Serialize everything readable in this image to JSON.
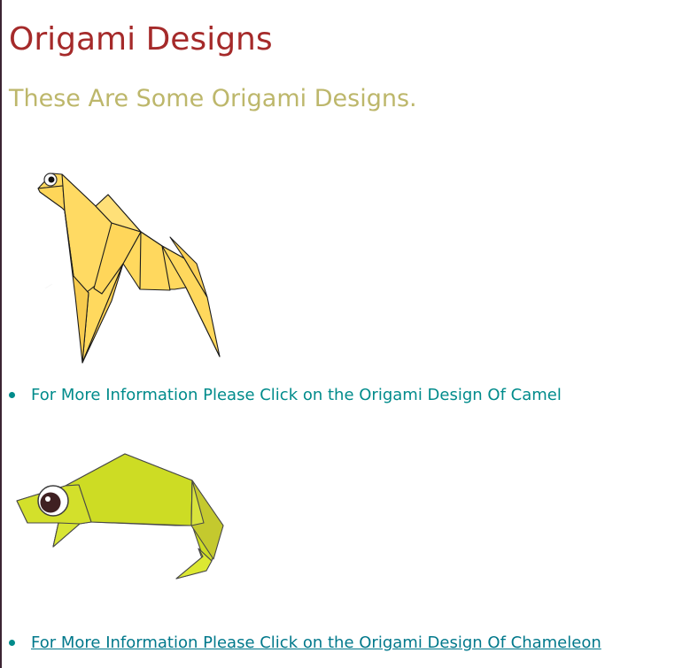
{
  "page": {
    "heading": "Origami Designs",
    "subheading": "These Are Some Origami Designs."
  },
  "designs": [
    {
      "image_icon": "camel-origami-icon",
      "text": "For More Information Please Click on the Origami Design Of Camel",
      "linked": false
    },
    {
      "image_icon": "chameleon-origami-icon",
      "text": "For More Information Please Click on the Origami Design Of Chameleon",
      "linked": true
    }
  ],
  "colors": {
    "heading": "#a52a2a",
    "subheading": "#bdb76b",
    "text": "#008b8b",
    "link": "#00788b",
    "camel": "#ffd95e",
    "chameleon": "#cddc24"
  }
}
